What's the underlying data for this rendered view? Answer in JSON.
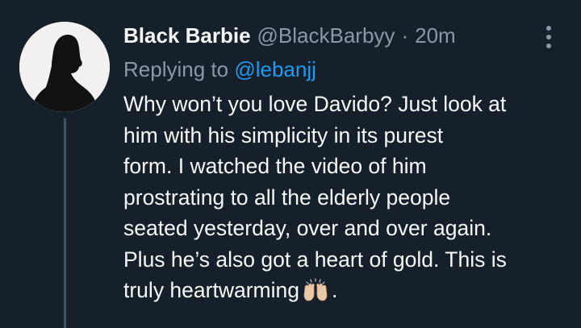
{
  "tweet": {
    "display_name": "Black Barbie",
    "handle": "@BlackBarbyy",
    "separator": "·",
    "time": "20m",
    "replying_prefix": "Replying to",
    "replying_handle": "@lebanjj",
    "body_lines": [
      "Why won’t you love Davido? Just look at",
      "him with his simplicity in its purest",
      "form. I watched the video of him",
      "prostrating to all the elderly people",
      "seated yesterday, over and over again.",
      "Plus he’s also got a heart of gold. This is"
    ],
    "body_last_line_text": "truly heartwarming",
    "body_last_line_end": ".",
    "emoji_name": "raising-hands-icon"
  },
  "icons": {
    "more": "more-vertical-icon",
    "avatar": "avatar-silhouette"
  },
  "colors": {
    "background": "#15202b",
    "text_primary": "#f7f9f9",
    "text_secondary": "#8b98a5",
    "link": "#1d9bf0",
    "thread_line": "#3d5466"
  }
}
